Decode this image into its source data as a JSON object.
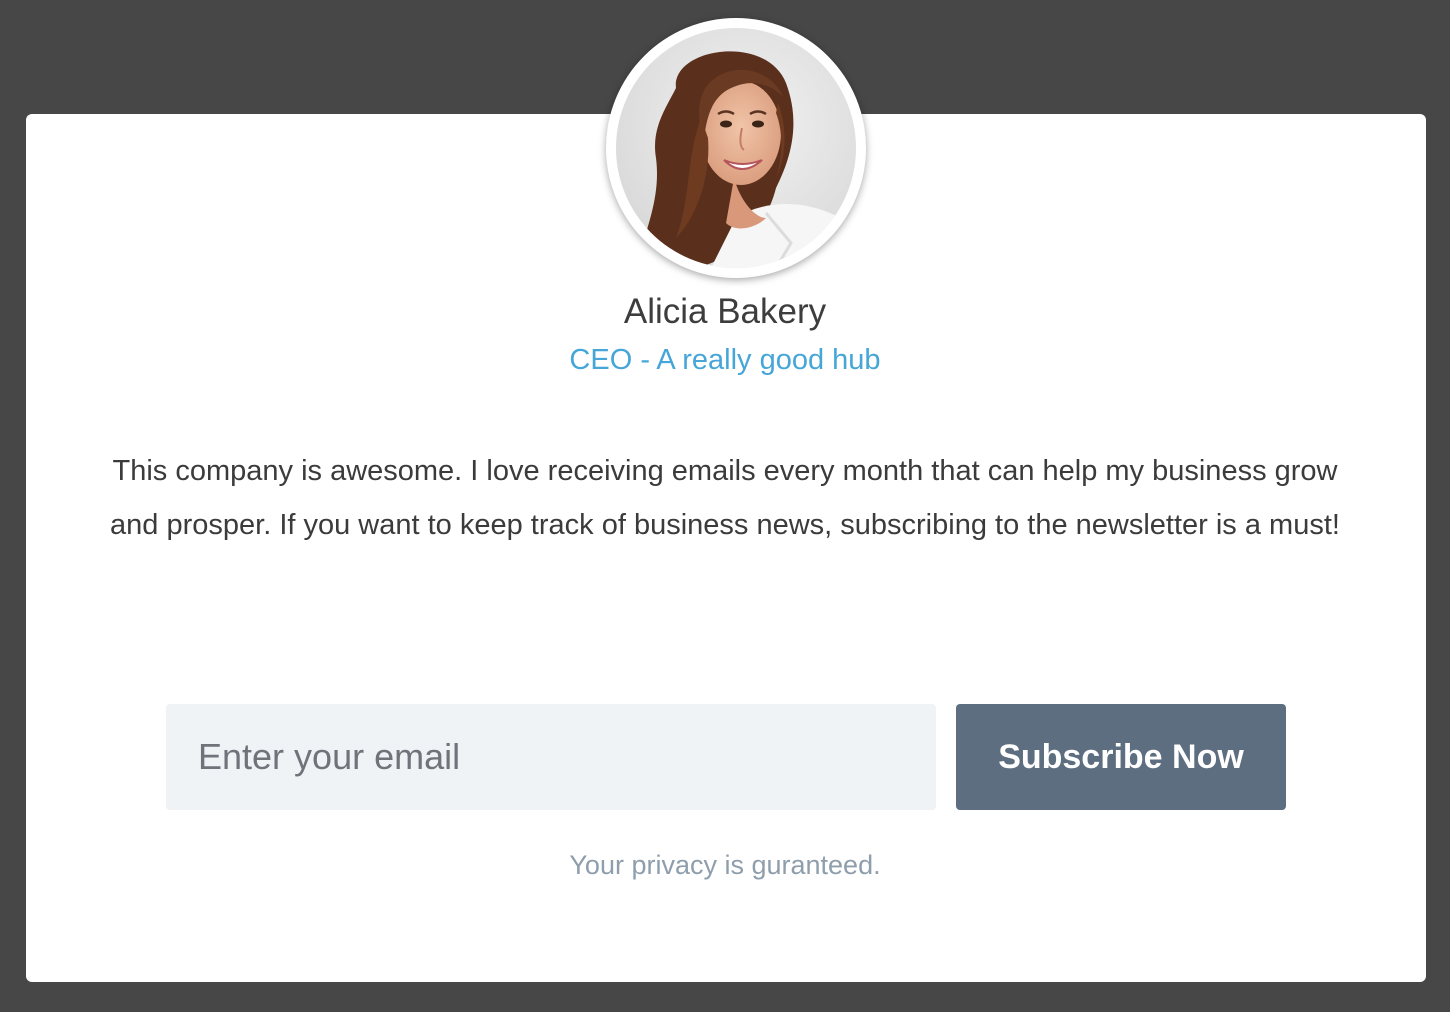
{
  "testimonial": {
    "name": "Alicia Bakery",
    "role": "CEO - A really good hub",
    "quote": "This company is awesome. I love receiving emails every month that can help my business grow and prosper. If you want to keep track of business news, subscribing to the newsletter is a must!"
  },
  "form": {
    "email_placeholder": "Enter your email",
    "email_value": "",
    "subscribe_label": "Subscribe Now",
    "privacy_note": "Your privacy is guranteed."
  },
  "colors": {
    "page_background": "#474747",
    "card_background": "#ffffff",
    "role_text": "#46a6d8",
    "button_background": "#5d6e80",
    "input_background": "#eff3f6",
    "privacy_text": "#8e9eac"
  }
}
